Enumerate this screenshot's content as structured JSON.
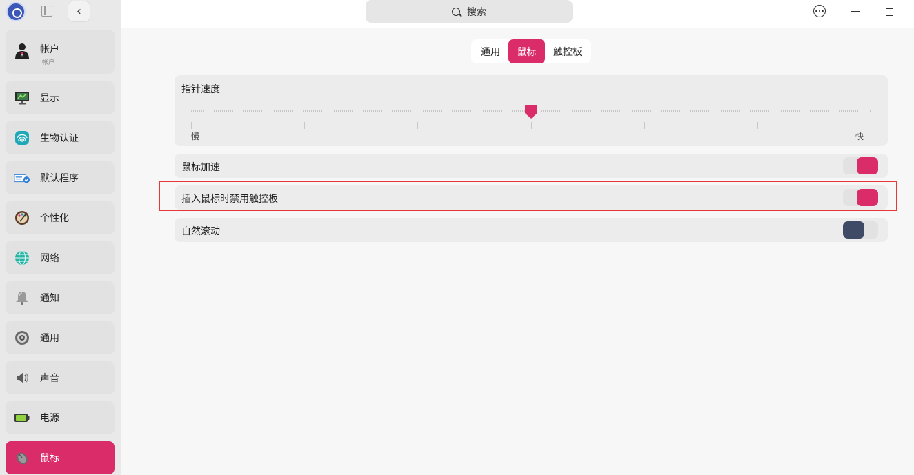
{
  "sidebar": {
    "account": {
      "label": "帐户",
      "sub": "帐户"
    },
    "items": [
      {
        "label": "显示",
        "icon": "monitor-icon"
      },
      {
        "label": "生物认证",
        "icon": "fingerprint-icon"
      },
      {
        "label": "默认程序",
        "icon": "default-apps-icon"
      },
      {
        "label": "个性化",
        "icon": "palette-icon"
      },
      {
        "label": "网络",
        "icon": "network-globe-icon"
      },
      {
        "label": "通知",
        "icon": "bell-icon"
      },
      {
        "label": "通用",
        "icon": "general-gear-icon"
      },
      {
        "label": "声音",
        "icon": "speaker-icon"
      },
      {
        "label": "电源",
        "icon": "battery-icon"
      },
      {
        "label": "鼠标",
        "icon": "mouse-icon"
      }
    ],
    "back_label": "‹"
  },
  "titlebar": {
    "search_placeholder": "搜索"
  },
  "tabs": [
    {
      "label": "通用",
      "active": false
    },
    {
      "label": "鼠标",
      "active": true
    },
    {
      "label": "触控板",
      "active": false
    }
  ],
  "pointer_speed": {
    "title": "指针速度",
    "min_label": "慢",
    "max_label": "快",
    "level": 0.5,
    "ticks": 7
  },
  "settings": [
    {
      "label": "鼠标加速",
      "enabled": true
    },
    {
      "label": "插入鼠标时禁用触控板",
      "enabled": true
    },
    {
      "label": "自然滚动",
      "enabled": false
    }
  ],
  "colors": {
    "accent": "#d92c68",
    "switch_off": "#3f4a66",
    "highlight": "#e53935"
  }
}
